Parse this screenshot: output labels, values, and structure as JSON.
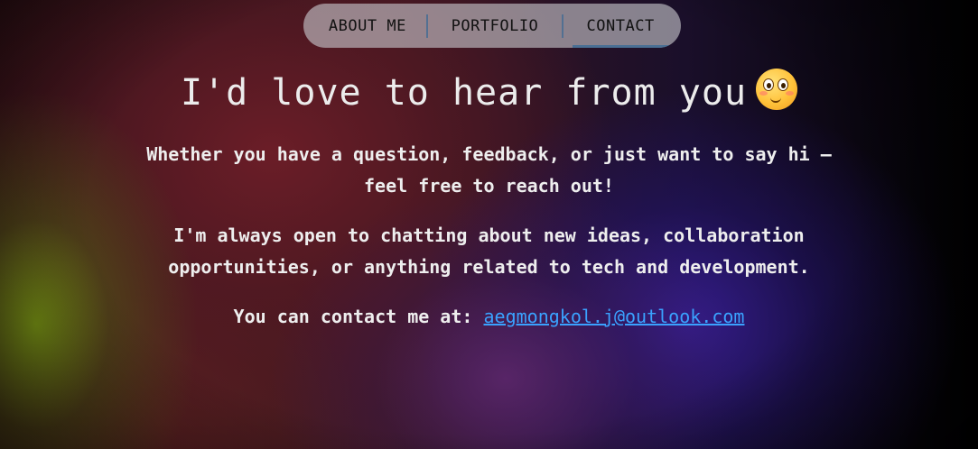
{
  "nav": {
    "items": [
      {
        "label": "ABOUT ME"
      },
      {
        "label": "PORTFOLIO"
      },
      {
        "label": "CONTACT"
      }
    ],
    "active": "CONTACT"
  },
  "heading": {
    "text": "I'd love to hear from you",
    "emoji": "smiling-face-with-wide-eyes"
  },
  "paragraphs": {
    "p1": [
      "Whether you have a question, feedback, or just want to say hi —",
      "feel free to reach out!"
    ],
    "p2": [
      "I'm always open to chatting about new ideas, collaboration",
      "opportunities, or anything related to tech and development."
    ],
    "p3_prefix": "You can contact me at: ",
    "email": "aegmongkol.j@outlook.com"
  },
  "colors": {
    "link": "#3aa2ff",
    "nav_active_underline": "#4a6f94"
  }
}
